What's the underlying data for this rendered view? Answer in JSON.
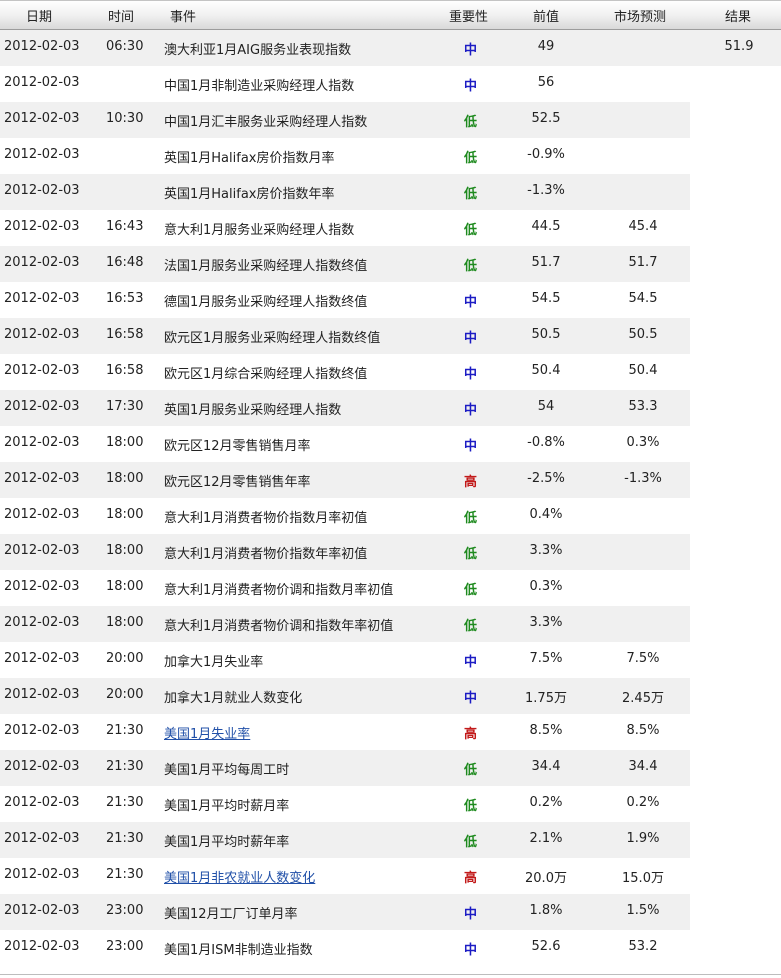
{
  "columns": {
    "date": "日期",
    "time": "时间",
    "event": "事件",
    "importance": "重要性",
    "previous": "前值",
    "forecast": "市场预测",
    "result": "结果"
  },
  "colors": {
    "low": "#1e8a1e",
    "medium": "#1c1cc4",
    "high": "#c21a1a",
    "link": "#2150a8"
  },
  "rows": [
    {
      "date": "2012-02-03",
      "time": "06:30",
      "event": "澳大利亚1月AIG服务业表现指数",
      "importance": "中",
      "level": "medium",
      "previous": "49",
      "forecast": "",
      "result": "51.9",
      "link": false
    },
    {
      "date": "2012-02-03",
      "time": "",
      "event": "中国1月非制造业采购经理人指数",
      "importance": "中",
      "level": "medium",
      "previous": "56",
      "forecast": "",
      "result": "",
      "link": false
    },
    {
      "date": "2012-02-03",
      "time": "10:30",
      "event": "中国1月汇丰服务业采购经理人指数",
      "importance": "低",
      "level": "low",
      "previous": "52.5",
      "forecast": "",
      "result": "",
      "link": false
    },
    {
      "date": "2012-02-03",
      "time": "",
      "event": "英国1月Halifax房价指数月率",
      "importance": "低",
      "level": "low",
      "previous": "-0.9%",
      "forecast": "",
      "result": "",
      "link": false
    },
    {
      "date": "2012-02-03",
      "time": "",
      "event": "英国1月Halifax房价指数年率",
      "importance": "低",
      "level": "low",
      "previous": "-1.3%",
      "forecast": "",
      "result": "",
      "link": false
    },
    {
      "date": "2012-02-03",
      "time": "16:43",
      "event": "意大利1月服务业采购经理人指数",
      "importance": "低",
      "level": "low",
      "previous": "44.5",
      "forecast": "45.4",
      "result": "",
      "link": false
    },
    {
      "date": "2012-02-03",
      "time": "16:48",
      "event": "法国1月服务业采购经理人指数终值",
      "importance": "低",
      "level": "low",
      "previous": "51.7",
      "forecast": "51.7",
      "result": "",
      "link": false
    },
    {
      "date": "2012-02-03",
      "time": "16:53",
      "event": "德国1月服务业采购经理人指数终值",
      "importance": "中",
      "level": "medium",
      "previous": "54.5",
      "forecast": "54.5",
      "result": "",
      "link": false
    },
    {
      "date": "2012-02-03",
      "time": "16:58",
      "event": "欧元区1月服务业采购经理人指数终值",
      "importance": "中",
      "level": "medium",
      "previous": "50.5",
      "forecast": "50.5",
      "result": "",
      "link": false
    },
    {
      "date": "2012-02-03",
      "time": "16:58",
      "event": "欧元区1月综合采购经理人指数终值",
      "importance": "中",
      "level": "medium",
      "previous": "50.4",
      "forecast": "50.4",
      "result": "",
      "link": false
    },
    {
      "date": "2012-02-03",
      "time": "17:30",
      "event": "英国1月服务业采购经理人指数",
      "importance": "中",
      "level": "medium",
      "previous": "54",
      "forecast": "53.3",
      "result": "",
      "link": false
    },
    {
      "date": "2012-02-03",
      "time": "18:00",
      "event": "欧元区12月零售销售月率",
      "importance": "中",
      "level": "medium",
      "previous": "-0.8%",
      "forecast": "0.3%",
      "result": "",
      "link": false
    },
    {
      "date": "2012-02-03",
      "time": "18:00",
      "event": "欧元区12月零售销售年率",
      "importance": "高",
      "level": "high",
      "previous": "-2.5%",
      "forecast": "-1.3%",
      "result": "",
      "link": false
    },
    {
      "date": "2012-02-03",
      "time": "18:00",
      "event": "意大利1月消费者物价指数月率初值",
      "importance": "低",
      "level": "low",
      "previous": "0.4%",
      "forecast": "",
      "result": "",
      "link": false
    },
    {
      "date": "2012-02-03",
      "time": "18:00",
      "event": "意大利1月消费者物价指数年率初值",
      "importance": "低",
      "level": "low",
      "previous": "3.3%",
      "forecast": "",
      "result": "",
      "link": false
    },
    {
      "date": "2012-02-03",
      "time": "18:00",
      "event": "意大利1月消费者物价调和指数月率初值",
      "importance": "低",
      "level": "low",
      "previous": "0.3%",
      "forecast": "",
      "result": "",
      "link": false
    },
    {
      "date": "2012-02-03",
      "time": "18:00",
      "event": "意大利1月消费者物价调和指数年率初值",
      "importance": "低",
      "level": "low",
      "previous": "3.3%",
      "forecast": "",
      "result": "",
      "link": false
    },
    {
      "date": "2012-02-03",
      "time": "20:00",
      "event": "加拿大1月失业率",
      "importance": "中",
      "level": "medium",
      "previous": "7.5%",
      "forecast": "7.5%",
      "result": "",
      "link": false
    },
    {
      "date": "2012-02-03",
      "time": "20:00",
      "event": "加拿大1月就业人数变化",
      "importance": "中",
      "level": "medium",
      "previous": "1.75万",
      "forecast": "2.45万",
      "result": "",
      "link": false
    },
    {
      "date": "2012-02-03",
      "time": "21:30",
      "event": "美国1月失业率",
      "importance": "高",
      "level": "high",
      "previous": "8.5%",
      "forecast": "8.5%",
      "result": "",
      "link": true
    },
    {
      "date": "2012-02-03",
      "time": "21:30",
      "event": "美国1月平均每周工时",
      "importance": "低",
      "level": "low",
      "previous": "34.4",
      "forecast": "34.4",
      "result": "",
      "link": false
    },
    {
      "date": "2012-02-03",
      "time": "21:30",
      "event": "美国1月平均时薪月率",
      "importance": "低",
      "level": "low",
      "previous": "0.2%",
      "forecast": "0.2%",
      "result": "",
      "link": false
    },
    {
      "date": "2012-02-03",
      "time": "21:30",
      "event": "美国1月平均时薪年率",
      "importance": "低",
      "level": "low",
      "previous": "2.1%",
      "forecast": "1.9%",
      "result": "",
      "link": false
    },
    {
      "date": "2012-02-03",
      "time": "21:30",
      "event": "美国1月非农就业人数变化",
      "importance": "高",
      "level": "high",
      "previous": "20.0万",
      "forecast": "15.0万",
      "result": "",
      "link": true
    },
    {
      "date": "2012-02-03",
      "time": "23:00",
      "event": "美国12月工厂订单月率",
      "importance": "中",
      "level": "medium",
      "previous": "1.8%",
      "forecast": "1.5%",
      "result": "",
      "link": false
    },
    {
      "date": "2012-02-03",
      "time": "23:00",
      "event": "美国1月ISM非制造业指数",
      "importance": "中",
      "level": "medium",
      "previous": "52.6",
      "forecast": "53.2",
      "result": "",
      "link": false
    }
  ]
}
